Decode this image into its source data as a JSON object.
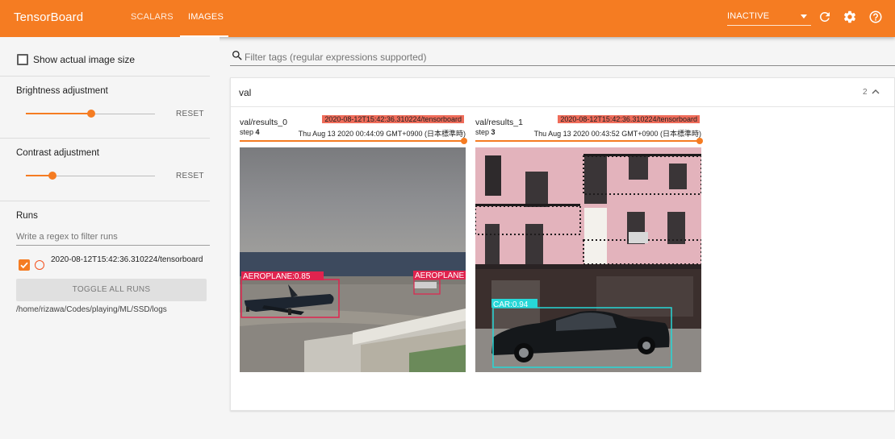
{
  "app": {
    "title": "TensorBoard",
    "accent": "#f57c22",
    "tabs": [
      {
        "label": "SCALARS",
        "active": false
      },
      {
        "label": "IMAGES",
        "active": true
      }
    ],
    "status_select": "INACTIVE",
    "icons": [
      "refresh-icon",
      "gear-icon",
      "help-icon"
    ]
  },
  "sidebar": {
    "show_actual_size": {
      "label": "Show actual image size",
      "checked": false
    },
    "brightness": {
      "title": "Brightness adjustment",
      "reset_label": "RESET",
      "value_fraction": 0.5
    },
    "contrast": {
      "title": "Contrast adjustment",
      "reset_label": "RESET",
      "value_fraction": 0.2
    },
    "runs": {
      "title": "Runs",
      "filter_placeholder": "Write a regex to filter runs",
      "items": [
        {
          "label": "2020-08-12T15:42:36.310224/tensorboard",
          "checked": true,
          "color": "#f4511e"
        }
      ],
      "toggle_all_label": "TOGGLE ALL RUNS",
      "logdir": "/home/rizawa/Codes/playing/ML/SSD/logs"
    }
  },
  "main": {
    "filter_placeholder": "Filter tags (regular expressions supported)",
    "card": {
      "title": "val",
      "count": "2",
      "images": [
        {
          "tag": "val/results_0",
          "run": "2020-08-12T15:42:36.310224/tensorboard",
          "step_label": "step",
          "step": "4",
          "date": "Thu Aug 13 2020 00:44:09 GMT+0900 (日本標準時)",
          "detections": [
            {
              "label": "AEROPLANE:0.85",
              "color": "#e0234e"
            },
            {
              "label": "AEROPLANE",
              "color": "#e0234e"
            }
          ]
        },
        {
          "tag": "val/results_1",
          "run": "2020-08-12T15:42:36.310224/tensorboard",
          "step_label": "step",
          "step": "3",
          "date": "Thu Aug 13 2020 00:43:52 GMT+0900 (日本標準時)",
          "detections": [
            {
              "label": "CAR:0.94",
              "color": "#27d7d7"
            }
          ]
        }
      ]
    }
  }
}
